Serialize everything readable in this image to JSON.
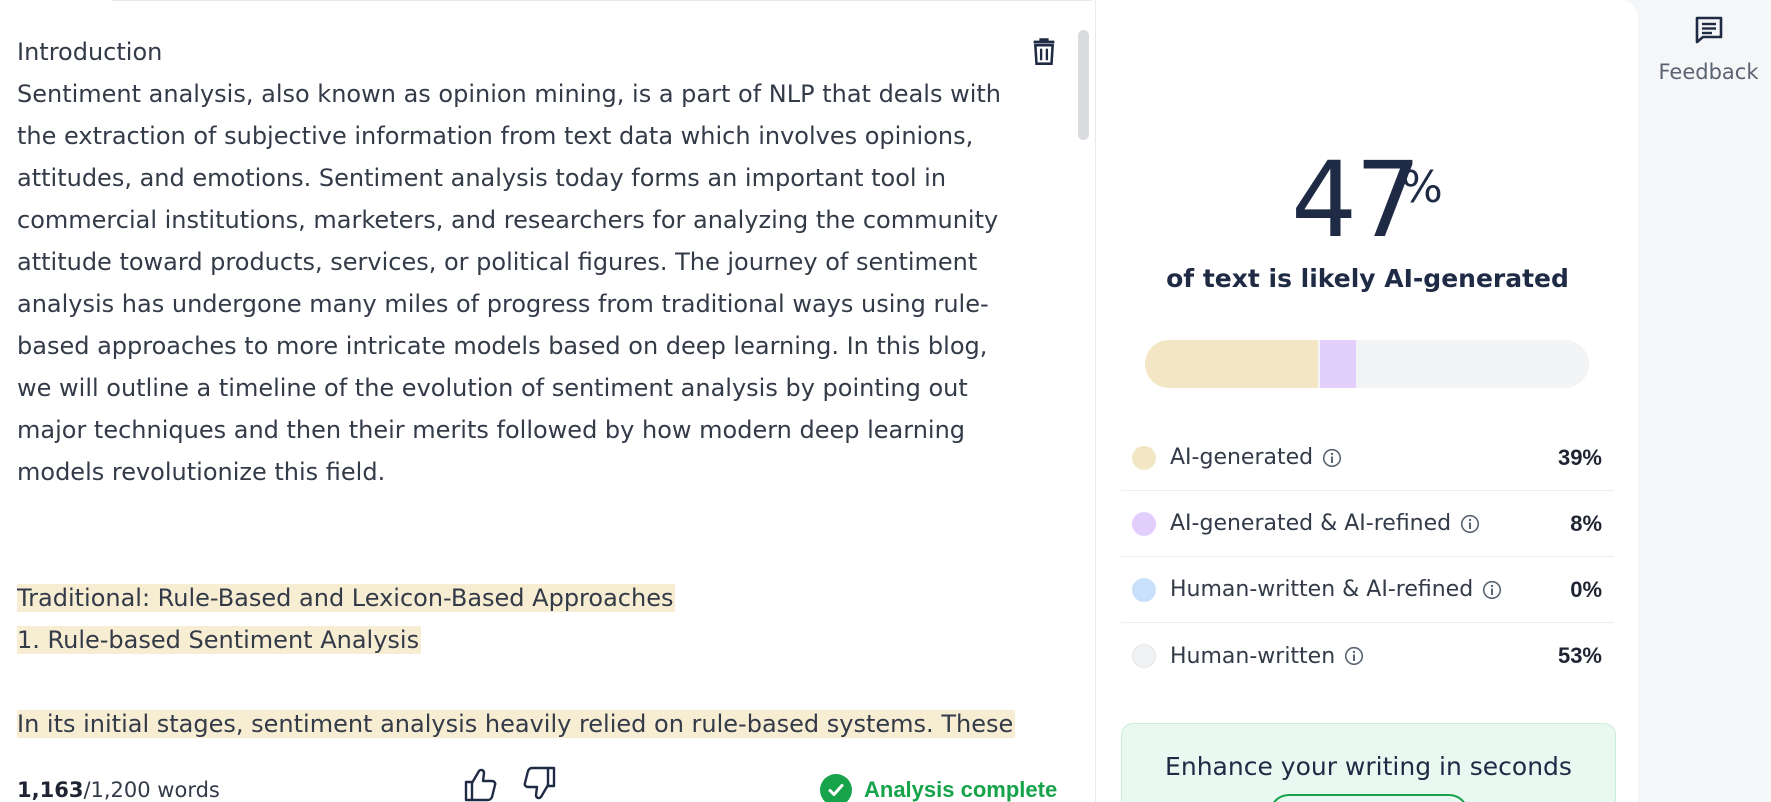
{
  "editor": {
    "paragraphs": [
      {
        "text": "Introduction",
        "highlight": false
      },
      {
        "text": "Sentiment analysis, also known as opinion mining, is a part of NLP that deals with the extraction of subjective information from text data which involves opinions, attitudes, and emotions. Sentiment analysis today forms an important tool in commercial institutions, marketers, and researchers for analyzing the community attitude toward products, services, or political figures. The journey of sentiment analysis has undergone many miles of progress from traditional ways using rule-based approaches to more intricate models based on deep learning. In this blog, we will outline a timeline of the evolution of sentiment analysis by pointing out major techniques and then their merits followed by how modern deep learning models revolutionize this field.",
        "highlight": false
      },
      {
        "text": "Traditional: Rule-Based and Lexicon-Based Approaches",
        "highlight": true
      },
      {
        "text": "1. Rule-based Sentiment Analysis",
        "highlight": true
      },
      {
        "text": "In its initial stages, sentiment analysis heavily relied on rule-based systems. These are systems that rely upon the application of predefined rules or patterns against input texts",
        "highlight": true
      }
    ],
    "word_count_current": "1,163",
    "word_count_limit": "/1,200 words",
    "delete_icon": "trash-icon",
    "status": "Analysis complete"
  },
  "result": {
    "score": "47",
    "score_unit": "%",
    "caption": "of text is likely AI-generated",
    "bar": [
      {
        "fraction": 0.39,
        "color": "#f3e6c4"
      },
      {
        "fraction": 0.08,
        "color": "#e2cffb"
      },
      {
        "fraction": 0.53,
        "color": "#f3f4f5"
      }
    ],
    "legend": [
      {
        "label": "AI-generated",
        "value": "39%",
        "color": "#f3e6c4"
      },
      {
        "label": "AI-generated & AI-refined",
        "value": "8%",
        "color": "#e2cffb"
      },
      {
        "label": "Human-written & AI-refined",
        "value": "0%",
        "color": "#c9e0fb"
      },
      {
        "label": "Human-written",
        "value": "53%",
        "color": "#f1f2f3"
      }
    ],
    "enhance_text": "Enhance your writing in seconds"
  },
  "feedback": {
    "label": "Feedback",
    "icon": "feedback-icon"
  },
  "colors": {
    "success": "#16a34a",
    "text_dark": "#1f2a44",
    "highlight": "#f7edd3"
  }
}
